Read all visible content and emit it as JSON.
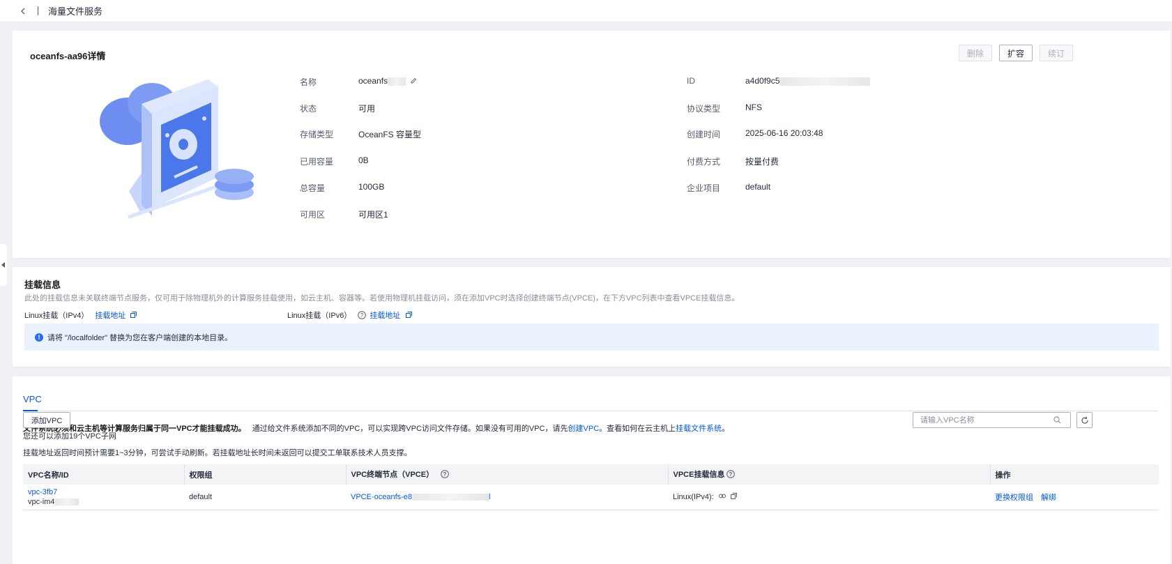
{
  "topbar": {
    "title": "海量文件服务"
  },
  "detail": {
    "title": "oceanfs-aa96详情",
    "buttons": {
      "delete": "删除",
      "expand": "扩容",
      "renew": "续订"
    },
    "left": [
      {
        "label": "名称",
        "value": "oceanfs"
      },
      {
        "label": "状态",
        "value": "可用"
      },
      {
        "label": "存储类型",
        "value": "OceanFS 容量型"
      },
      {
        "label": "已用容量",
        "value": "0B"
      },
      {
        "label": "总容量",
        "value": "100GB"
      },
      {
        "label": "可用区",
        "value": "可用区1"
      }
    ],
    "right": [
      {
        "label": "ID",
        "value": "a4d0f9c5"
      },
      {
        "label": "协议类型",
        "value": "NFS"
      },
      {
        "label": "创建时间",
        "value": "2025-06-16 20:03:48"
      },
      {
        "label": "付费方式",
        "value": "按量付费"
      },
      {
        "label": "企业项目",
        "value": "default"
      }
    ]
  },
  "mount": {
    "title": "挂载信息",
    "desc": "此处的挂载信息未关联终端节点服务，仅可用于除物理机外的计算服务挂载使用，如云主机、容器等。若使用物理机挂载访问，须在添加VPC时选择创建终端节点(VPCE)，在下方VPC列表中查看VPCE挂载信息。",
    "ipv4_label": "Linux挂载（IPv4）",
    "ipv4_link": "挂载地址",
    "ipv6_label": "Linux挂载（IPv6）",
    "ipv6_link": "挂载地址",
    "alert": "请将 \"/localfolder\" 替换为您在客户端创建的本地目录。"
  },
  "vpc": {
    "tab": "VPC",
    "desc_bold": "文件系统必须和云主机等计算服务归属于同一VPC才能挂载成功。",
    "desc_part1": "通过给文件系统添加不同的VPC，可以实现跨VPC访问文件存储。如果没有可用的VPC，请先",
    "desc_link1": "创建VPC",
    "desc_part2": "。查看如何在云主机上",
    "desc_link2": "挂载文件系统",
    "desc_part3": "。",
    "add_button": "添加VPC",
    "remaining": "您还可以添加19个VPC子网",
    "note": "挂载地址返回时间预计需要1~3分钟，可尝试手动刷新。若挂载地址长时间未返回可以提交工单联系技术人员支撑。",
    "search_placeholder": "请输入VPC名称",
    "columns": [
      "VPC名称/ID",
      "权限组",
      "VPC终端节点（VPCE）",
      "VPCE挂载信息",
      "操作"
    ],
    "rows": [
      {
        "vpc_name": "vpc-3fb7",
        "vpc_id": "vpc-im4",
        "perm_group": "default",
        "vpce": "VPCE-oceanfs-e8",
        "mount_info": "Linux(IPv4):",
        "action_change": "更换权限组",
        "action_unbind": "解绑"
      }
    ]
  }
}
